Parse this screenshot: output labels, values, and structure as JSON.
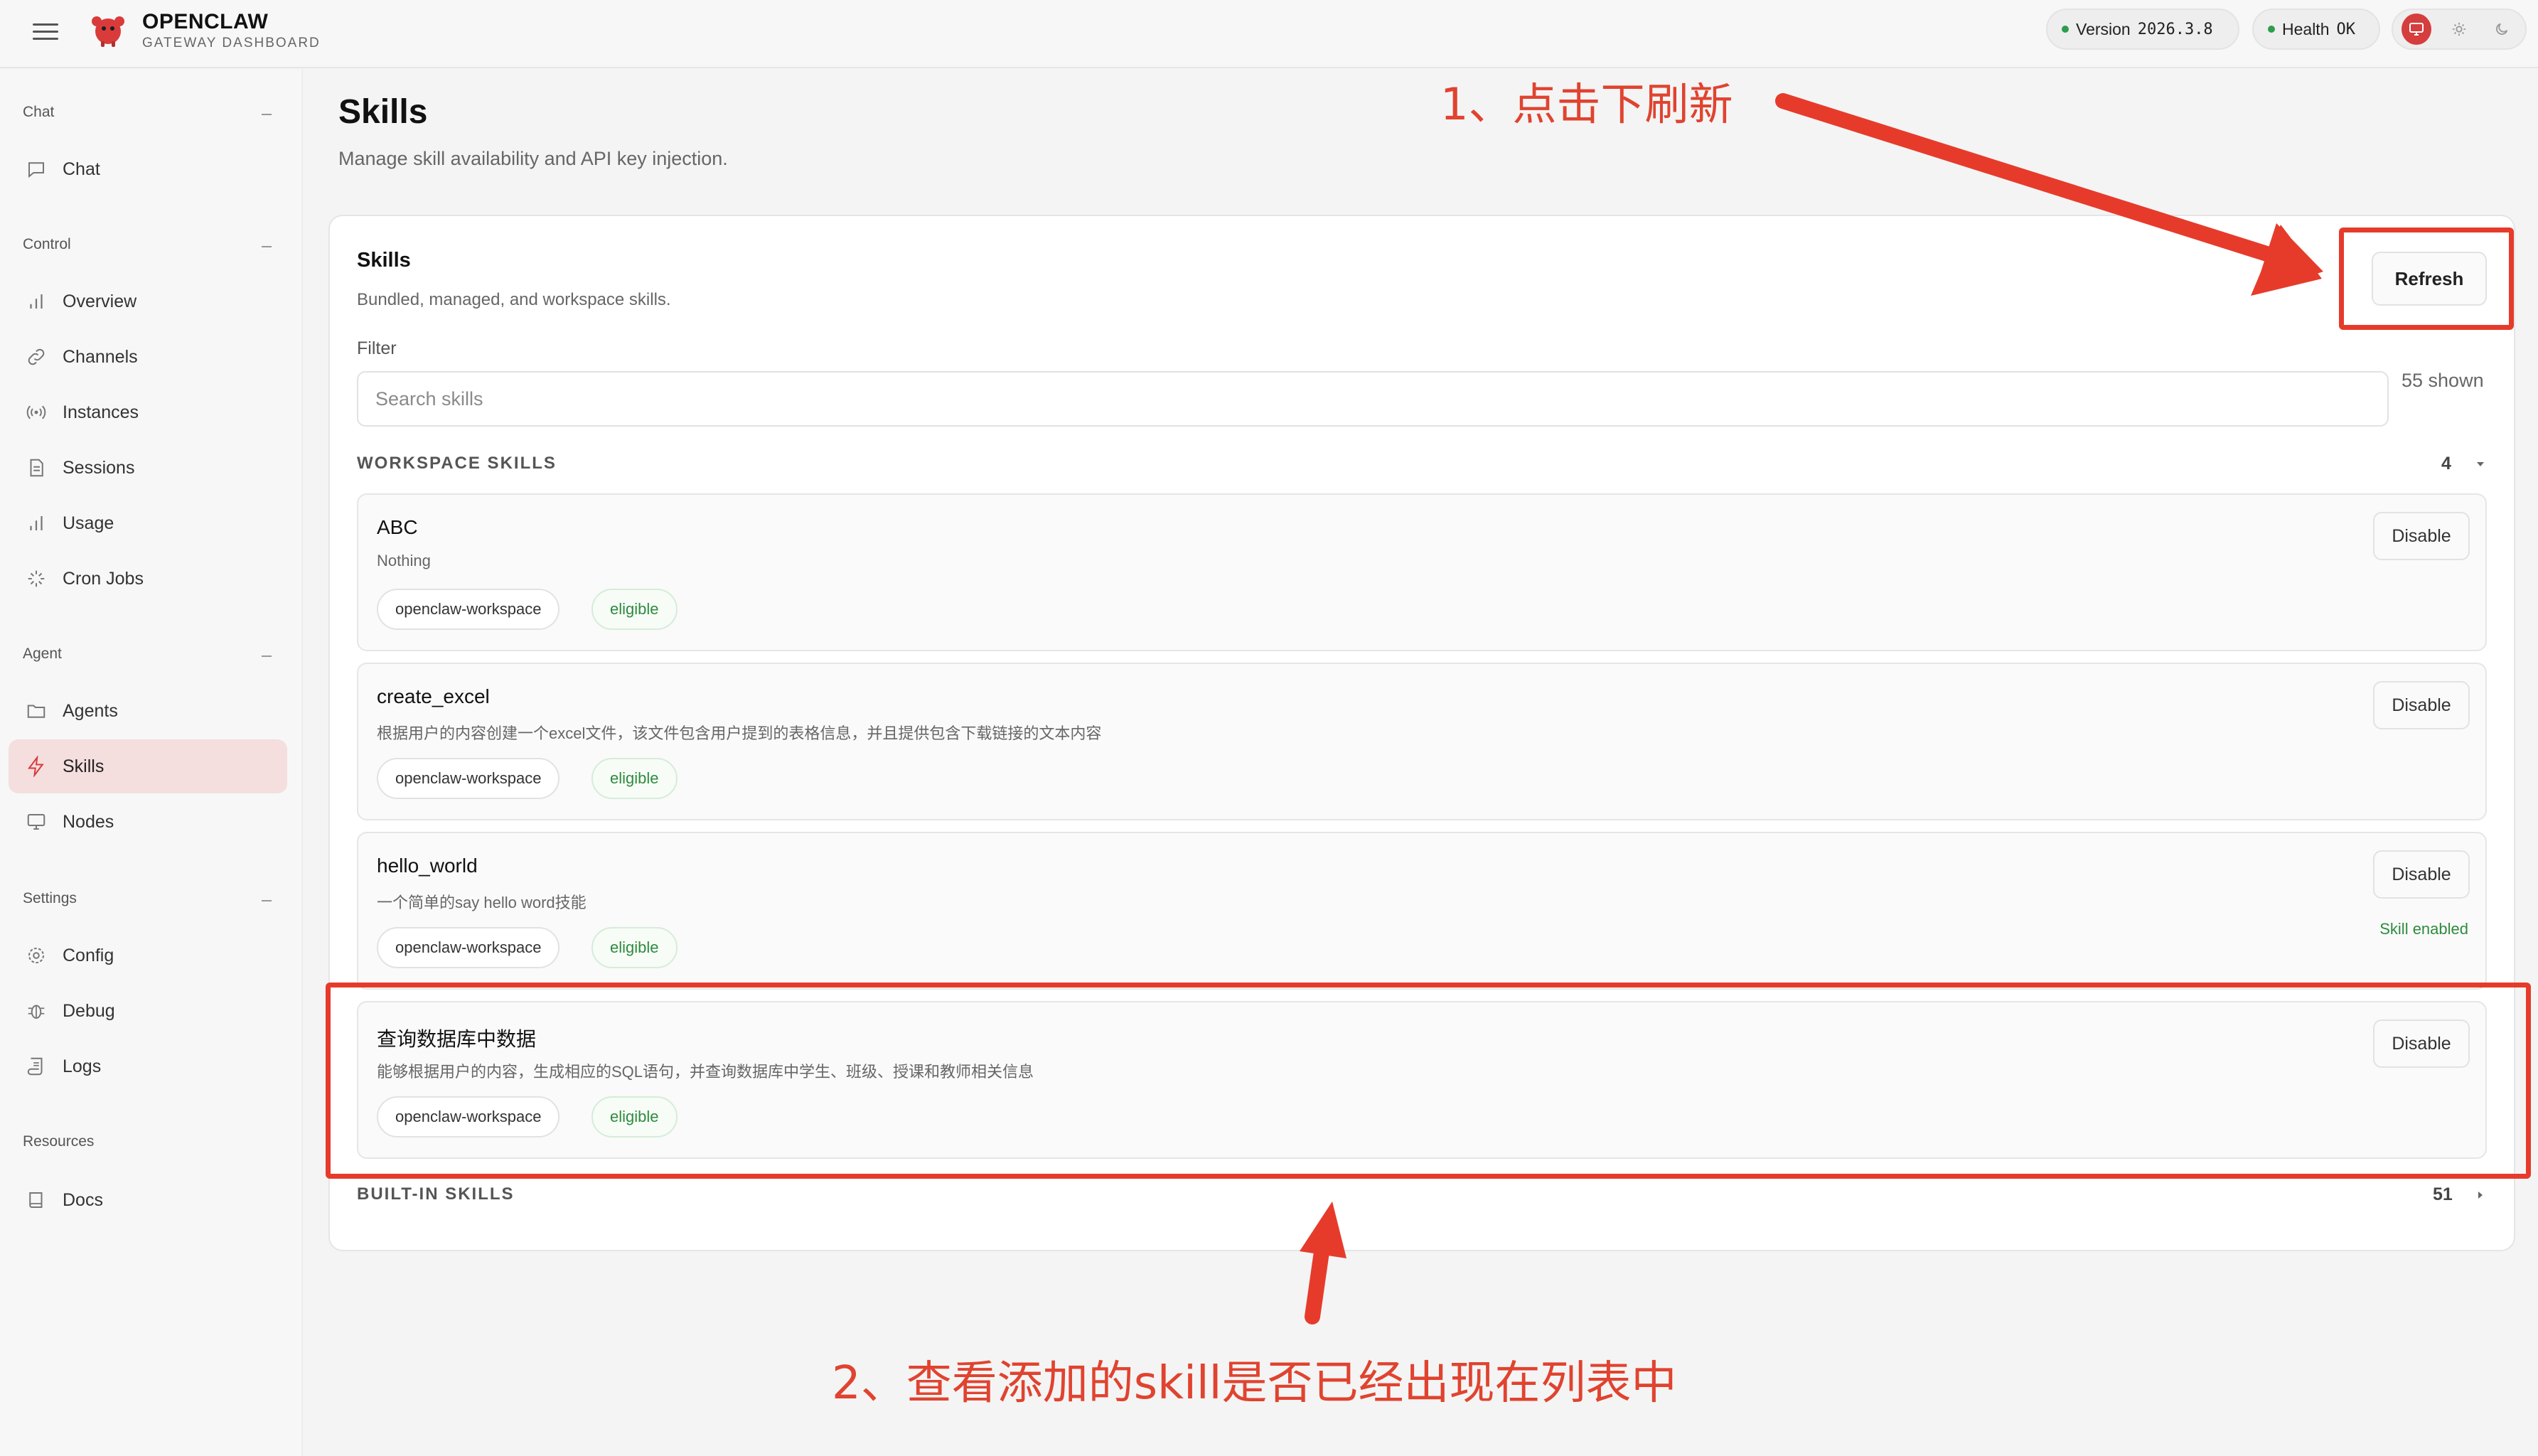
{
  "header": {
    "brand_title": "OPENCLAW",
    "brand_subtitle": "GATEWAY DASHBOARD",
    "version_label": "Version",
    "version_value": "2026.3.8",
    "health_label": "Health",
    "health_value": "OK",
    "status_color": "#2e9d4d"
  },
  "sidebar": {
    "sections": [
      {
        "title": "Chat",
        "items": [
          {
            "label": "Chat",
            "icon": "chat-icon"
          }
        ]
      },
      {
        "title": "Control",
        "items": [
          {
            "label": "Overview",
            "icon": "bar-chart-icon"
          },
          {
            "label": "Channels",
            "icon": "link-icon"
          },
          {
            "label": "Instances",
            "icon": "radio-icon"
          },
          {
            "label": "Sessions",
            "icon": "document-icon"
          },
          {
            "label": "Usage",
            "icon": "bar-chart-icon"
          },
          {
            "label": "Cron Jobs",
            "icon": "loader-icon"
          }
        ]
      },
      {
        "title": "Agent",
        "items": [
          {
            "label": "Agents",
            "icon": "folder-icon"
          },
          {
            "label": "Skills",
            "icon": "bolt-icon",
            "active": true
          },
          {
            "label": "Nodes",
            "icon": "monitor-icon"
          }
        ]
      },
      {
        "title": "Settings",
        "items": [
          {
            "label": "Config",
            "icon": "gear-icon"
          },
          {
            "label": "Debug",
            "icon": "bug-icon"
          },
          {
            "label": "Logs",
            "icon": "scroll-icon"
          }
        ]
      },
      {
        "title": "Resources",
        "items": [
          {
            "label": "Docs",
            "icon": "book-icon"
          }
        ]
      }
    ],
    "active_color": "#f5dede"
  },
  "page": {
    "title": "Skills",
    "subtitle": "Manage skill availability and API key injection."
  },
  "card": {
    "title": "Skills",
    "subtitle": "Bundled, managed, and workspace skills.",
    "refresh_label": "Refresh",
    "filter_label": "Filter",
    "search_placeholder": "Search skills",
    "shown_text": "55 shown"
  },
  "workspace_group": {
    "title": "WORKSPACE SKILLS",
    "count": "4",
    "skills": [
      {
        "name": "ABC",
        "description": "Nothing",
        "source": "openclaw-workspace",
        "status": "eligible",
        "button": "Disable"
      },
      {
        "name": "create_excel",
        "description": "根据用户的内容创建一个excel文件，该文件包含用户提到的表格信息，并且提供包含下载链接的文本内容",
        "source": "openclaw-workspace",
        "status": "eligible",
        "button": "Disable"
      },
      {
        "name": "hello_world",
        "description": "一个简单的say hello word技能",
        "source": "openclaw-workspace",
        "status": "eligible",
        "button": "Disable",
        "message": "Skill enabled"
      },
      {
        "name": "查询数据库中数据",
        "description": "能够根据用户的内容，生成相应的SQL语句，并查询数据库中学生、班级、授课和教师相关信息",
        "source": "openclaw-workspace",
        "status": "eligible",
        "button": "Disable"
      }
    ]
  },
  "builtin_group": {
    "title": "BUILT-IN SKILLS",
    "count": "51"
  },
  "annotations": {
    "step1": "1、点击下刷新",
    "step2": "2、查看添加的skill是否已经出现在列表中",
    "color": "#e0432f"
  }
}
